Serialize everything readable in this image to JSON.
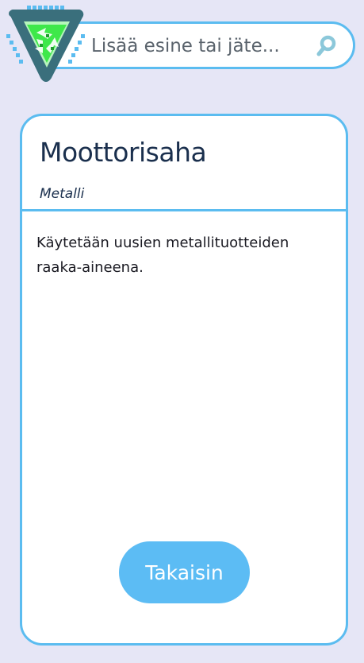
{
  "app": {
    "logo_icon": "recycle-triangle-icon"
  },
  "search": {
    "placeholder": "Lisää esine tai jäte...",
    "value": "",
    "icon": "search-icon"
  },
  "item": {
    "name": "Moottorisaha",
    "category": "Metalli",
    "description": "Käytetään uusien metallituotteiden raaka-aineena."
  },
  "actions": {
    "back_label": "Takaisin"
  },
  "colors": {
    "background": "#e6e6f6",
    "accent": "#5bbcf0",
    "button": "#5cbcf4",
    "title_text": "#1a2f4d",
    "logo_frame": "#3a6f7c",
    "logo_green": "#3ee84a"
  }
}
